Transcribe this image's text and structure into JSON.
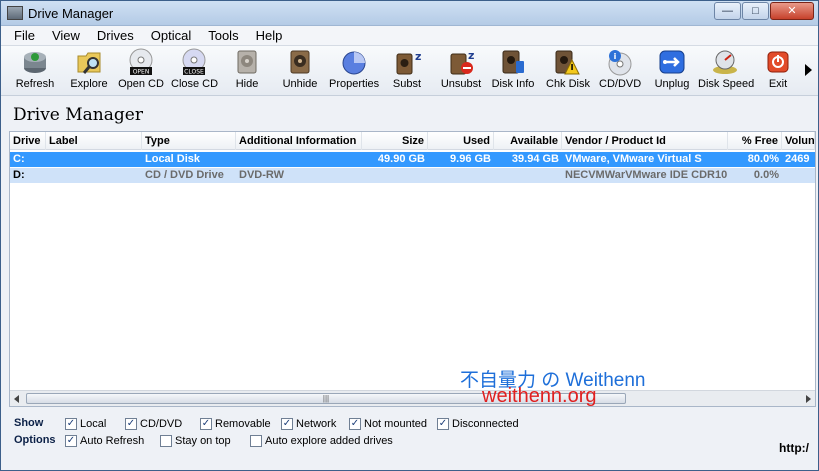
{
  "window": {
    "title": "Drive Manager",
    "min_label": "—",
    "max_label": "□",
    "close_label": "✕"
  },
  "menu": [
    {
      "label": "File"
    },
    {
      "label": "View"
    },
    {
      "label": "Drives"
    },
    {
      "label": "Optical"
    },
    {
      "label": "Tools"
    },
    {
      "label": "Help"
    }
  ],
  "toolbar": [
    {
      "label": "Refresh",
      "icon": "refresh-icon"
    },
    {
      "label": "Explore",
      "icon": "explore-icon"
    },
    {
      "label": "Open CD",
      "icon": "open-cd-icon",
      "badge": "OPEN"
    },
    {
      "label": "Close CD",
      "icon": "close-cd-icon",
      "badge": "CLOSE"
    },
    {
      "label": "Hide",
      "icon": "hide-drive-icon"
    },
    {
      "label": "Unhide",
      "icon": "unhide-drive-icon"
    },
    {
      "label": "Properties",
      "icon": "properties-pie-icon"
    },
    {
      "label": "Subst",
      "icon": "subst-icon"
    },
    {
      "label": "Unsubst",
      "icon": "unsubst-icon"
    },
    {
      "label": "Disk Info",
      "icon": "disk-info-icon"
    },
    {
      "label": "Chk Disk",
      "icon": "chk-disk-icon"
    },
    {
      "label": "CD/DVD",
      "icon": "cd-dvd-icon"
    },
    {
      "label": "Unplug",
      "icon": "unplug-icon"
    },
    {
      "label": "Disk Speed",
      "icon": "disk-speed-icon"
    },
    {
      "label": "Exit",
      "icon": "exit-icon"
    }
  ],
  "heading": "Drive Manager",
  "columns": {
    "drive": "Drive",
    "label": "Label",
    "type": "Type",
    "info": "Additional Information",
    "size": "Size",
    "used": "Used",
    "available": "Available",
    "vendor": "Vendor / Product Id",
    "free": "% Free",
    "volume": "Volun"
  },
  "rows": [
    {
      "drive": "C:",
      "label": "",
      "type": "Local Disk",
      "info": "",
      "size": "49.90 GB",
      "used": "9.96 GB",
      "available": "39.94 GB",
      "vendor": "VMware, VMware Virtual S",
      "free": "80.0%",
      "volume": "2469"
    },
    {
      "drive": "D:",
      "label": "",
      "type": "CD / DVD Drive",
      "info": "DVD-RW",
      "size": "",
      "used": "",
      "available": "",
      "vendor": "NECVMWarVMware IDE CDR10",
      "free": "0.0%",
      "volume": ""
    }
  ],
  "scroll_grip": "|||",
  "watermark": {
    "line1": "不自量力 の Weithenn",
    "line2": "weithenn.org"
  },
  "options": {
    "show_label": "Show",
    "options_label": "Options",
    "show": [
      {
        "label": "Local",
        "checked": true
      },
      {
        "label": "CD/DVD",
        "checked": true
      },
      {
        "label": "Removable",
        "checked": true
      },
      {
        "label": "Network",
        "checked": true
      },
      {
        "label": "Not mounted",
        "checked": true
      },
      {
        "label": "Disconnected",
        "checked": true
      }
    ],
    "opts": [
      {
        "label": "Auto Refresh",
        "checked": true
      },
      {
        "label": "Stay on top",
        "checked": false
      },
      {
        "label": "Auto explore added drives",
        "checked": false
      }
    ]
  },
  "status_url": "http:/"
}
